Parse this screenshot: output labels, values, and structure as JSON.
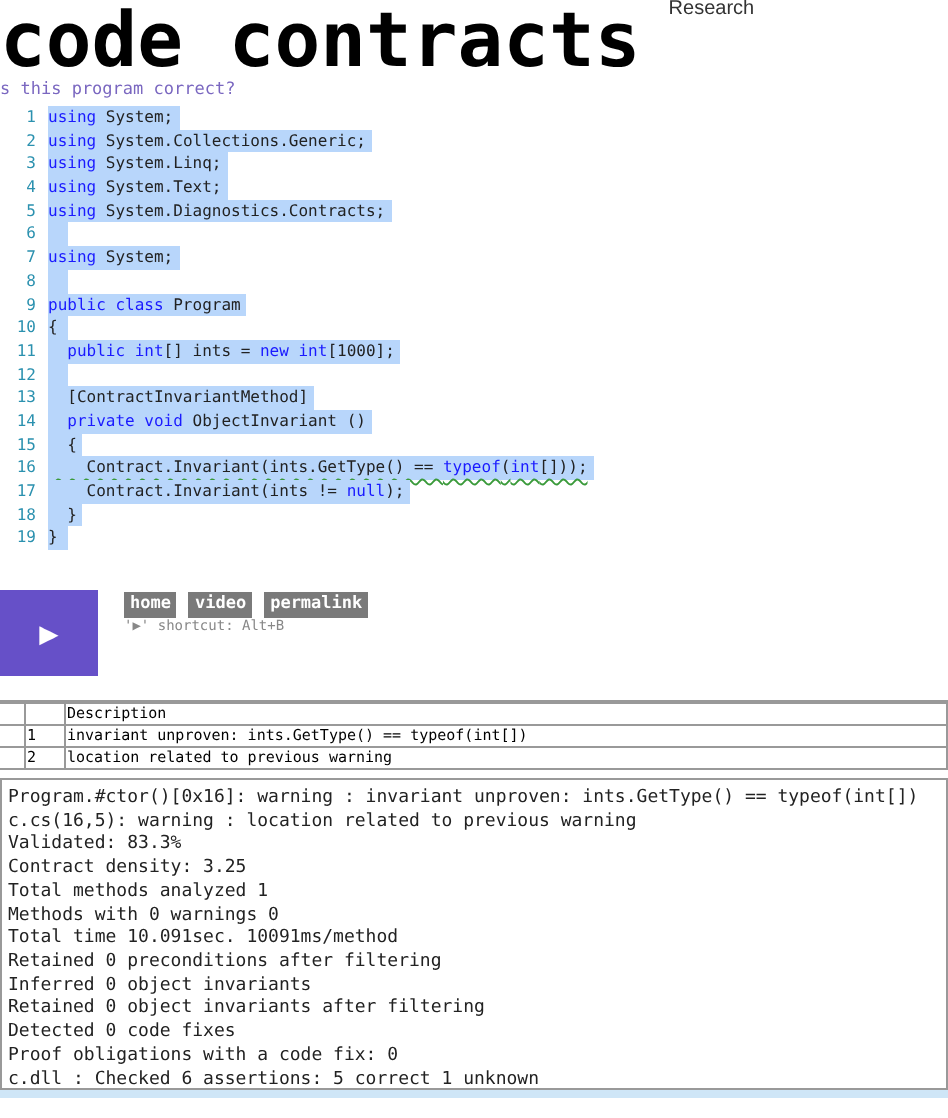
{
  "header": {
    "title": "code contracts",
    "brand": "Research",
    "question": "s this program correct?"
  },
  "code": {
    "lines": [
      {
        "number": "1",
        "tokens": [
          {
            "kind": "keyword",
            "text": "using"
          },
          {
            "kind": "plain",
            "text": " System;"
          }
        ]
      },
      {
        "number": "2",
        "tokens": [
          {
            "kind": "keyword",
            "text": "using"
          },
          {
            "kind": "plain",
            "text": " System.Collections.Generic;"
          }
        ]
      },
      {
        "number": "3",
        "tokens": [
          {
            "kind": "keyword",
            "text": "using"
          },
          {
            "kind": "plain",
            "text": " System.Linq;"
          }
        ]
      },
      {
        "number": "4",
        "tokens": [
          {
            "kind": "keyword",
            "text": "using"
          },
          {
            "kind": "plain",
            "text": " System.Text;"
          }
        ]
      },
      {
        "number": "5",
        "tokens": [
          {
            "kind": "keyword",
            "text": "using"
          },
          {
            "kind": "plain",
            "text": " System.Diagnostics.Contracts;"
          }
        ]
      },
      {
        "number": "6"
      },
      {
        "number": "7",
        "tokens": [
          {
            "kind": "keyword",
            "text": "using"
          },
          {
            "kind": "plain",
            "text": " System;"
          }
        ]
      },
      {
        "number": "8"
      },
      {
        "number": "9",
        "tokens": [
          {
            "kind": "keyword",
            "text": "public class"
          },
          {
            "kind": "plain",
            "text": " Program"
          }
        ]
      },
      {
        "number": "10",
        "tokens": [
          {
            "kind": "plain",
            "text": "{"
          }
        ]
      },
      {
        "number": "11",
        "tokens": [
          {
            "kind": "keyword",
            "text": "  public int"
          },
          {
            "kind": "plain",
            "text": "[] ints = "
          },
          {
            "kind": "keyword",
            "text": "new int"
          },
          {
            "kind": "plain",
            "text": "[1000];"
          }
        ]
      },
      {
        "number": "12"
      },
      {
        "number": "13",
        "tokens": [
          {
            "kind": "plain",
            "text": "  [ContractInvariantMethod]"
          }
        ]
      },
      {
        "number": "14",
        "tokens": [
          {
            "kind": "keyword",
            "text": "  private void"
          },
          {
            "kind": "plain",
            "text": " ObjectInvariant ()"
          }
        ]
      },
      {
        "number": "15",
        "tokens": [
          {
            "kind": "plain",
            "text": "  {"
          }
        ]
      },
      {
        "number": "16",
        "warning": true,
        "tokens": [
          {
            "kind": "plain",
            "text": "    Contract.Invariant(ints.GetType() == "
          },
          {
            "kind": "keyword",
            "text": "typeof"
          },
          {
            "kind": "plain",
            "text": "("
          },
          {
            "kind": "keyword",
            "text": "int"
          },
          {
            "kind": "plain",
            "text": "[]));"
          }
        ]
      },
      {
        "number": "17",
        "tokens": [
          {
            "kind": "plain",
            "text": "    Contract.Invariant(ints != "
          },
          {
            "kind": "keyword",
            "text": "null"
          },
          {
            "kind": "plain",
            "text": ");"
          }
        ]
      },
      {
        "number": "18",
        "tokens": [
          {
            "kind": "plain",
            "text": "  }"
          }
        ]
      },
      {
        "number": "19",
        "tokens": [
          {
            "kind": "plain",
            "text": "}"
          }
        ]
      }
    ]
  },
  "play_button": {
    "glyph": "▶"
  },
  "links": [
    "home",
    "video",
    "permalink"
  ],
  "shortcut": "'▶' shortcut: Alt+B",
  "table": {
    "columns": [
      "",
      "",
      "Description"
    ],
    "rows": [
      [
        "",
        "1",
        "invariant unproven: ints.GetType() == typeof(int[])"
      ],
      [
        "",
        "2",
        "location related to previous warning"
      ]
    ]
  },
  "output": [
    "Program.#ctor()[0x16]: warning : invariant unproven: ints.GetType() == typeof(int[])",
    "c.cs(16,5): warning : location related to previous warning",
    "Validated: 83.3%",
    "Contract density: 3.25",
    "Total methods analyzed 1",
    "Methods with 0 warnings 0",
    "Total time 10.091sec. 10091ms/method",
    "Retained 0 preconditions after filtering",
    "Inferred 0 object invariants",
    "Retained 0 object invariants after filtering",
    "Detected 0 code fixes",
    "Proof obligations with a code fix: 0",
    "c.dll : Checked 6 assertions: 5 correct 1 unknown"
  ]
}
